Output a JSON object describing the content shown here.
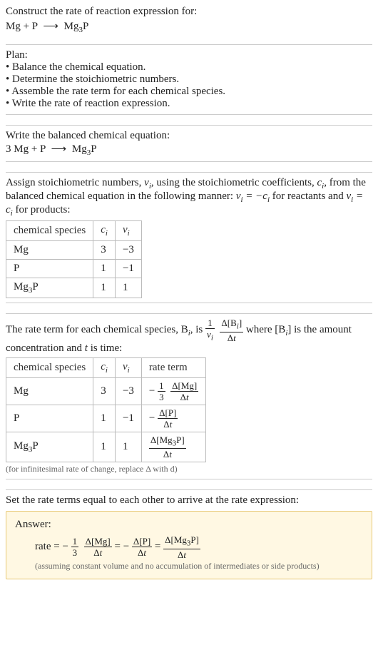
{
  "header": {
    "prompt": "Construct the rate of reaction expression for:",
    "equation_lhs": "Mg + P",
    "arrow": "⟶",
    "equation_rhs": "Mg",
    "equation_rhs_sub": "3",
    "equation_rhs_tail": "P"
  },
  "plan": {
    "title": "Plan:",
    "items": [
      "Balance the chemical equation.",
      "Determine the stoichiometric numbers.",
      "Assemble the rate term for each chemical species.",
      "Write the rate of reaction expression."
    ]
  },
  "balanced": {
    "title": "Write the balanced chemical equation:",
    "lhs": "3 Mg + P",
    "arrow": "⟶",
    "rhs": "Mg",
    "rhs_sub": "3",
    "rhs_tail": "P"
  },
  "assign": {
    "intro1": "Assign stoichiometric numbers, ",
    "nu": "ν",
    "i": "i",
    "intro2": ", using the stoichiometric coefficients, ",
    "c": "c",
    "intro3": ", from the balanced chemical equation in the following manner: ",
    "rel1a": "ν",
    "rel1b": " = −c",
    "intro4": " for reactants and ",
    "rel2a": "ν",
    "rel2b": " = c",
    "intro5": " for products:",
    "headers": [
      "chemical species",
      "cᵢ",
      "νᵢ"
    ],
    "rows": [
      {
        "sp": "Mg",
        "c": "3",
        "nu": "−3"
      },
      {
        "sp": "P",
        "c": "1",
        "nu": "−1"
      },
      {
        "sp_html": "Mg<sub>3</sub>P",
        "c": "1",
        "nu": "1"
      }
    ]
  },
  "rate_term": {
    "line1a": "The rate term for each chemical species, B",
    "line1b": ", is ",
    "frac1_num": "1",
    "frac1_den": "ν",
    "frac2_num": "Δ[B",
    "frac2_num2": "]",
    "frac2_den": "Δt",
    "line1c": " where [B",
    "line1d": "] is the amount concentration and ",
    "t": "t",
    "line1e": " is time:",
    "headers": [
      "chemical species",
      "cᵢ",
      "νᵢ",
      "rate term"
    ],
    "rows": [
      {
        "sp": "Mg",
        "c": "3",
        "nu": "−3",
        "lead": "−",
        "f1n": "1",
        "f1d": "3",
        "f2n": "Δ[Mg]",
        "f2d": "Δt"
      },
      {
        "sp": "P",
        "c": "1",
        "nu": "−1",
        "lead": "−",
        "f1n": "",
        "f1d": "",
        "f2n": "Δ[P]",
        "f2d": "Δt"
      },
      {
        "sp_html": "Mg<sub>3</sub>P",
        "c": "1",
        "nu": "1",
        "lead": "",
        "f1n": "",
        "f1d": "",
        "f2n": "Δ[Mg<sub>3</sub>P]",
        "f2d": "Δt"
      }
    ],
    "note": "(for infinitesimal rate of change, replace Δ with d)"
  },
  "final": {
    "intro": "Set the rate terms equal to each other to arrive at the rate expression:",
    "answer_label": "Answer:",
    "rate_eq_lead": "rate = −",
    "t1_f1n": "1",
    "t1_f1d": "3",
    "t1_f2n": "Δ[Mg]",
    "t1_f2d": "Δt",
    "eq": " = ",
    "t2_lead": "−",
    "t2_f2n": "Δ[P]",
    "t2_f2d": "Δt",
    "t3_f2n": "Δ[Mg<sub>3</sub>P]",
    "t3_f2d": "Δt",
    "note": "(assuming constant volume and no accumulation of intermediates or side products)"
  }
}
